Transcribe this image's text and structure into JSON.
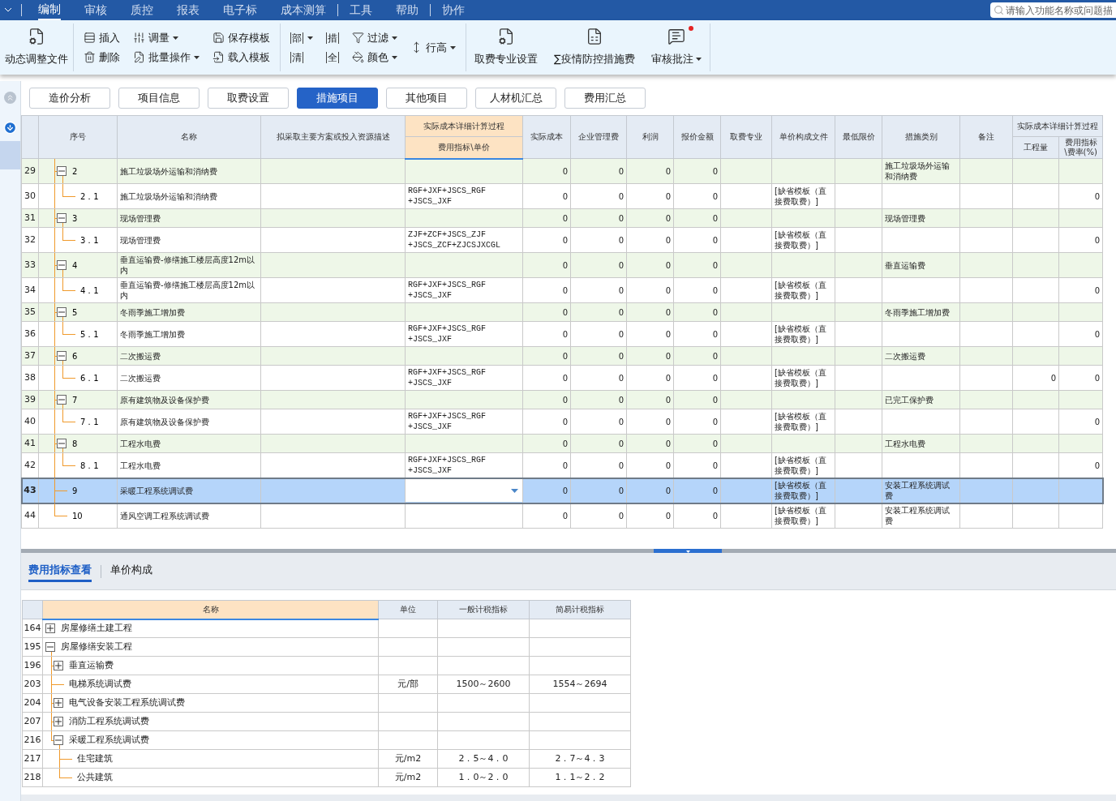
{
  "menu_bar": {
    "groups": [
      [
        {
          "label": "编制",
          "selected": true
        },
        {
          "label": "审核",
          "selected": false
        },
        {
          "label": "质控",
          "selected": false
        },
        {
          "label": "报表",
          "selected": false
        },
        {
          "label": "电子标",
          "selected": false
        },
        {
          "label": "成本测算",
          "selected": false
        }
      ],
      [
        {
          "label": "工具",
          "selected": false
        },
        {
          "label": "帮助",
          "selected": false
        }
      ],
      [
        {
          "label": "协作",
          "selected": false
        }
      ]
    ],
    "search": {
      "placeholder": "请输入功能名称或问题描"
    }
  },
  "ribbon": {
    "sections": [
      {
        "columns": [
          [
            {
              "label": "动态调整文件",
              "kind": "large",
              "menu": false
            }
          ]
        ]
      },
      {
        "columns": [
          [
            {
              "label": "插入",
              "kind": "small",
              "menu": false
            },
            {
              "label": "删除",
              "kind": "small",
              "menu": false
            }
          ],
          [
            {
              "label": "调量",
              "kind": "small",
              "menu": true
            },
            {
              "label": "批量操作",
              "kind": "small",
              "menu": true
            }
          ],
          [
            {
              "label": "保存模板",
              "kind": "small",
              "menu": false
            },
            {
              "label": "载入模板",
              "kind": "small",
              "menu": false
            }
          ]
        ]
      },
      {
        "columns": [
          [
            {
              "label": "部",
              "kind": "glyph",
              "menu": true
            },
            {
              "label": "清",
              "kind": "glyph",
              "menu": false
            }
          ],
          [
            {
              "label": "措",
              "kind": "glyph",
              "menu": false
            },
            {
              "label": "全",
              "kind": "glyph",
              "menu": false
            }
          ],
          [
            {
              "label": "过滤",
              "kind": "small",
              "menu": true
            },
            {
              "label": "颜色",
              "kind": "small",
              "menu": true
            }
          ],
          [
            {
              "label": "行高",
              "kind": "small",
              "menu": true
            }
          ]
        ]
      },
      {
        "columns": [
          [
            {
              "label": "取费专业设置",
              "kind": "large",
              "menu": false
            }
          ],
          [
            {
              "label": "∑疫情防控措施费",
              "kind": "large",
              "menu": false
            }
          ],
          [
            {
              "label": "审核批注",
              "kind": "large",
              "menu": true,
              "dot": true
            }
          ]
        ]
      }
    ]
  },
  "view_tabs": [
    {
      "label": "造价分析",
      "selected": false
    },
    {
      "label": "项目信息",
      "selected": false
    },
    {
      "label": "取费设置",
      "selected": false
    },
    {
      "label": "措施项目",
      "selected": true
    },
    {
      "label": "其他项目",
      "selected": false
    },
    {
      "label": "人材机汇总",
      "selected": false
    },
    {
      "label": "费用汇总",
      "selected": false
    }
  ],
  "measures": {
    "columns": [
      {
        "label": "序号",
        "selected": false
      },
      {
        "label": "名称",
        "selected": false
      },
      {
        "label": "拟采取主要方案或投入资源描述",
        "selected": false
      },
      {
        "group": "实际成本详细计算过程",
        "selected": true,
        "children": [
          {
            "label": "费用指标\\单价"
          }
        ]
      },
      {
        "label": "实际成本",
        "selected": false
      },
      {
        "label": "企业管理费",
        "selected": false
      },
      {
        "label": "利润",
        "selected": false
      },
      {
        "label": "报价金额",
        "selected": false
      },
      {
        "label": "取费专业",
        "selected": false
      },
      {
        "label": "单价构成文件",
        "selected": false
      },
      {
        "label": "最低限价",
        "selected": false
      },
      {
        "label": "措施类别",
        "selected": false
      },
      {
        "label": "备注",
        "selected": false
      },
      {
        "group": "实际成本详细计算过程",
        "selected": false,
        "children": [
          {
            "label": "工程量"
          },
          {
            "label": "费用指标\\费率(%)"
          }
        ]
      }
    ],
    "rows": [
      {
        "row": "29",
        "code": "2",
        "name": "施工垃圾场外运输和消纳费",
        "actual_cost": "0",
        "mgmt_fee": "0",
        "profit": "0",
        "quote": "0",
        "category": "施工垃圾场外运输和消纳费",
        "selected": false,
        "expanded": true,
        "children": [
          {
            "row": "30",
            "code": "2．1",
            "name": "施工垃圾场外运输和消纳费",
            "formula": "RGF+JXF+JSCS_RGF+JSCS_JXF",
            "actual_cost": "0",
            "mgmt_fee": "0",
            "profit": "0",
            "quote": "0",
            "price_file": "[缺省模板（直接费取费）]",
            "rate": "0",
            "selected": false
          }
        ]
      },
      {
        "row": "31",
        "code": "3",
        "name": "现场管理费",
        "actual_cost": "0",
        "mgmt_fee": "0",
        "profit": "0",
        "quote": "0",
        "category": "现场管理费",
        "selected": false,
        "expanded": true,
        "children": [
          {
            "row": "32",
            "code": "3．1",
            "name": "现场管理费",
            "formula": "ZJF+ZCF+JSCS_ZJF+JSCS_ZCF+ZJCSJXCGL",
            "actual_cost": "0",
            "mgmt_fee": "0",
            "profit": "0",
            "quote": "0",
            "price_file": "[缺省模板（直接费取费）]",
            "rate": "0",
            "selected": false
          }
        ]
      },
      {
        "row": "33",
        "code": "4",
        "name": "垂直运输费-修缮施工楼层高度12m以内",
        "actual_cost": "0",
        "mgmt_fee": "0",
        "profit": "0",
        "quote": "0",
        "category": "垂直运输费",
        "selected": false,
        "expanded": true,
        "children": [
          {
            "row": "34",
            "code": "4．1",
            "name": "垂直运输费-修缮施工楼层高度12m以内",
            "formula": "RGF+JXF+JSCS_RGF+JSCS_JXF",
            "actual_cost": "0",
            "mgmt_fee": "0",
            "profit": "0",
            "quote": "0",
            "price_file": "[缺省模板（直接费取费）]",
            "rate": "0",
            "selected": false
          }
        ]
      },
      {
        "row": "35",
        "code": "5",
        "name": "冬雨季施工增加费",
        "actual_cost": "0",
        "mgmt_fee": "0",
        "profit": "0",
        "quote": "0",
        "category": "冬雨季施工增加费",
        "selected": false,
        "expanded": true,
        "children": [
          {
            "row": "36",
            "code": "5．1",
            "name": "冬雨季施工增加费",
            "formula": "RGF+JXF+JSCS_RGF+JSCS_JXF",
            "actual_cost": "0",
            "mgmt_fee": "0",
            "profit": "0",
            "quote": "0",
            "price_file": "[缺省模板（直接费取费）]",
            "rate": "0",
            "selected": false
          }
        ]
      },
      {
        "row": "37",
        "code": "6",
        "name": "二次搬运费",
        "actual_cost": "0",
        "mgmt_fee": "0",
        "profit": "0",
        "quote": "0",
        "category": "二次搬运费",
        "selected": false,
        "expanded": true,
        "children": [
          {
            "row": "38",
            "code": "6．1",
            "name": "二次搬运费",
            "formula": "RGF+JXF+JSCS_RGF+JSCS_JXF",
            "actual_cost": "0",
            "mgmt_fee": "0",
            "profit": "0",
            "quote": "0",
            "price_file": "[缺省模板（直接费取费）]",
            "quantity": "0",
            "rate": "0",
            "selected": false
          }
        ]
      },
      {
        "row": "39",
        "code": "7",
        "name": "原有建筑物及设备保护费",
        "actual_cost": "0",
        "mgmt_fee": "0",
        "profit": "0",
        "quote": "0",
        "category": "已完工保护费",
        "selected": false,
        "expanded": true,
        "children": [
          {
            "row": "40",
            "code": "7．1",
            "name": "原有建筑物及设备保护费",
            "formula": "RGF+JXF+JSCS_RGF+JSCS_JXF",
            "actual_cost": "0",
            "mgmt_fee": "0",
            "profit": "0",
            "quote": "0",
            "price_file": "[缺省模板（直接费取费）]",
            "rate": "0",
            "selected": false
          }
        ]
      },
      {
        "row": "41",
        "code": "8",
        "name": "工程水电费",
        "actual_cost": "0",
        "mgmt_fee": "0",
        "profit": "0",
        "quote": "0",
        "category": "工程水电费",
        "selected": false,
        "expanded": true,
        "children": [
          {
            "row": "42",
            "code": "8．1",
            "name": "工程水电费",
            "formula": "RGF+JXF+JSCS_RGF+JSCS_JXF",
            "actual_cost": "0",
            "mgmt_fee": "0",
            "profit": "0",
            "quote": "0",
            "price_file": "[缺省模板（直接费取费）]",
            "rate": "0",
            "selected": false
          }
        ]
      },
      {
        "row": "43",
        "code": "9",
        "name": "采暖工程系统调试费",
        "actual_cost": "0",
        "mgmt_fee": "0",
        "profit": "0",
        "quote": "0",
        "price_file": "[缺省模板（直接费取费）]",
        "category": "安装工程系统调试费",
        "selected": true
      },
      {
        "row": "44",
        "code": "10",
        "name": "通风空调工程系统调试费",
        "actual_cost": "0",
        "mgmt_fee": "0",
        "profit": "0",
        "quote": "0",
        "price_file": "[缺省模板（直接费取费）]",
        "category": "安装工程系统调试费",
        "selected": false
      }
    ]
  },
  "index_view": {
    "tabs": [
      {
        "label": "费用指标查看",
        "selected": true
      },
      {
        "label": "单价构成",
        "selected": false
      }
    ],
    "table": {
      "columns": [
        {
          "label": "名称",
          "selected": true
        },
        {
          "label": "单位",
          "selected": false
        },
        {
          "label": "一般计税指标",
          "selected": false
        },
        {
          "label": "简易计税指标",
          "selected": false
        }
      ],
      "rows": [
        {
          "row": "164",
          "name": "房屋修缮土建工程",
          "expanded": false
        },
        {
          "row": "195",
          "name": "房屋修缮安装工程",
          "expanded": true,
          "children": [
            {
              "row": "196",
              "name": "垂直运输费",
              "expanded": false
            },
            {
              "row": "203",
              "name": "电梯系统调试费",
              "unit": "元/部",
              "general": "1500～2600",
              "simple": "1554～2694"
            },
            {
              "row": "204",
              "name": "电气设备安装工程系统调试费",
              "expanded": false
            },
            {
              "row": "207",
              "name": "消防工程系统调试费",
              "expanded": false
            },
            {
              "row": "216",
              "name": "采暖工程系统调试费",
              "expanded": true,
              "children": [
                {
                  "row": "217",
                  "name": "住宅建筑",
                  "unit": "元/m2",
                  "general": "2．5～4．0",
                  "simple": "2．7～4．3"
                },
                {
                  "row": "218",
                  "name": "公共建筑",
                  "unit": "元/m2",
                  "general": "1．0～2．0",
                  "simple": "1．1～2．2"
                }
              ]
            }
          ]
        }
      ]
    }
  }
}
